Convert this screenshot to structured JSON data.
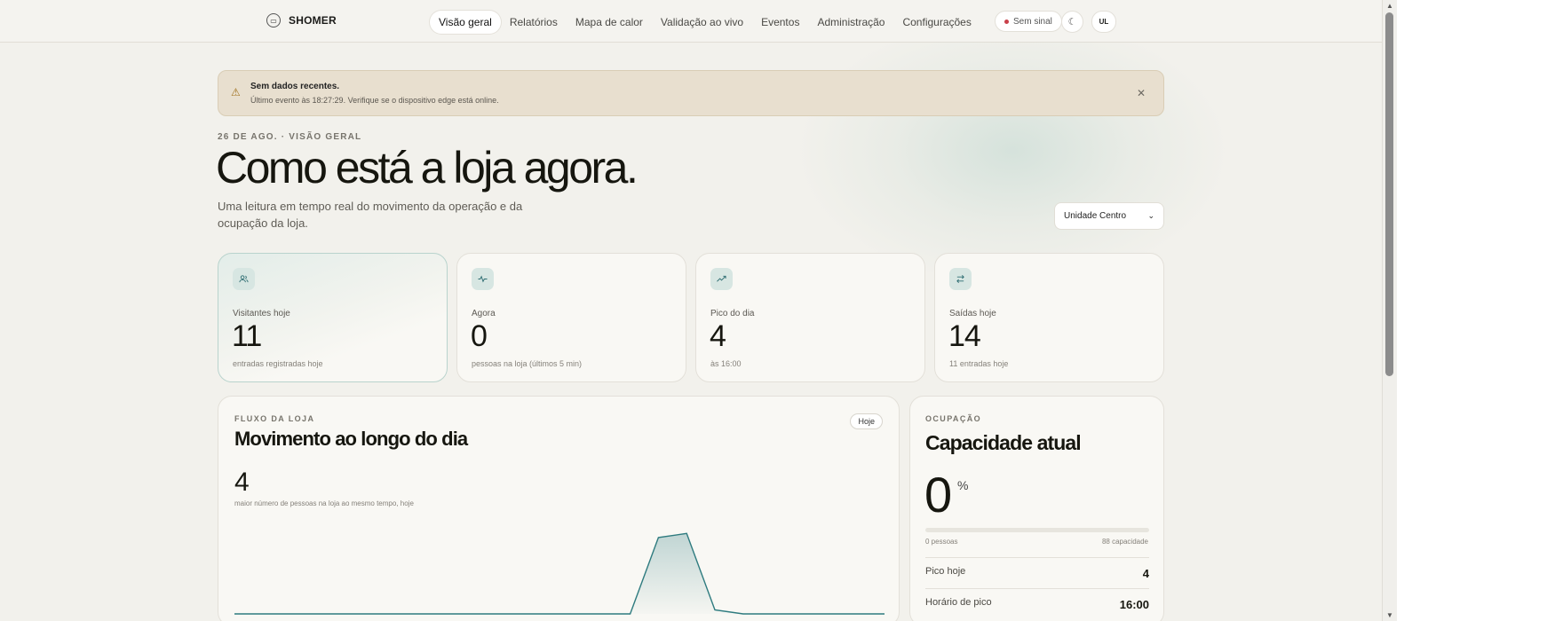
{
  "brand": {
    "name": "SHOMER",
    "logo_icon": "bar-chart-logo-icon"
  },
  "nav": {
    "items": [
      {
        "label": "Visão geral",
        "active": true
      },
      {
        "label": "Relatórios",
        "active": false
      },
      {
        "label": "Mapa de calor",
        "active": false
      },
      {
        "label": "Validação ao vivo",
        "active": false
      },
      {
        "label": "Eventos",
        "active": false
      },
      {
        "label": "Administração",
        "active": false
      },
      {
        "label": "Configurações",
        "active": false
      }
    ],
    "status": "Sem sinal",
    "status_color": "#c9404a",
    "avatar": "UL"
  },
  "alert": {
    "title": "Sem dados recentes.",
    "text": "Último evento às 18:27:29. Verifique se o dispositivo edge está online."
  },
  "header": {
    "eyebrow": "26 DE AGO. · VISÃO GERAL",
    "title": "Como está a loja agora.",
    "subtitle": "Uma leitura em tempo real do movimento da operação e da ocupação da loja.",
    "store": "Unidade Centro"
  },
  "kpis": [
    {
      "label": "Visitantes hoje",
      "value": "11",
      "note": "entradas registradas hoje",
      "icon": "users-icon"
    },
    {
      "label": "Agora",
      "value": "0",
      "note": "pessoas na loja (últimos 5 min)",
      "icon": "pulse-icon"
    },
    {
      "label": "Pico do dia",
      "value": "4",
      "note": "às 16:00",
      "icon": "trending-up-icon"
    },
    {
      "label": "Saídas hoje",
      "value": "14",
      "note": "11 entradas hoje",
      "icon": "arrows-swap-icon"
    }
  ],
  "flow": {
    "eyebrow": "FLUXO DA LOJA",
    "title": "Movimento ao longo do dia",
    "chip": "Hoje",
    "value": "4",
    "note": "maior número de pessoas na loja ao mesmo tempo, hoje"
  },
  "chart_data": {
    "type": "area",
    "title": "Movimento ao longo do dia",
    "xlabel": "",
    "ylabel": "",
    "x": [
      0,
      1,
      2,
      3,
      4,
      5,
      6,
      7,
      8,
      9,
      10,
      11,
      12,
      13,
      14,
      15,
      16,
      17,
      18,
      19,
      20,
      21,
      22,
      23
    ],
    "values": [
      0,
      0,
      0,
      0,
      0,
      0,
      0,
      0,
      0,
      0,
      0,
      0,
      0,
      0,
      0,
      3.8,
      4,
      0.2,
      0,
      0,
      0,
      0,
      0,
      0
    ],
    "ylim": [
      0,
      4.5
    ],
    "color": "#2e7b7f"
  },
  "occupancy": {
    "eyebrow": "OCUPAÇÃO",
    "title": "Capacidade atual",
    "value": "0",
    "unit": "%",
    "fill": 0,
    "people": "0 pessoas",
    "capacity": "88 capacidade",
    "rows": [
      {
        "label": "Pico hoje",
        "value": "4"
      },
      {
        "label": "Horário de pico",
        "value": "16:00"
      }
    ]
  }
}
